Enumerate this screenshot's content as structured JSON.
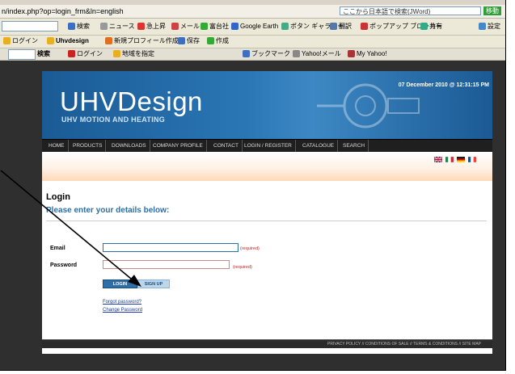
{
  "browser": {
    "url": "n/index.php?op=login_frm&ln=english",
    "search_placeholder": "ここから日本語で検索(JWord)",
    "go_label": "移動",
    "toolbar1": [
      "検索",
      "ニュース",
      "急上昇",
      "メール",
      "富台社",
      "Google Earth",
      "ポタン ギャラリー",
      "翻訳",
      "ポップアップ ブロッカー",
      "共有",
      "設定"
    ],
    "toolbar2": [
      "ログイン",
      "Uhvdesign",
      "新規プロフィール作成",
      "保存",
      "作成"
    ],
    "toolbar3": [
      "検索",
      "ログイン",
      "地域を指定",
      "ブックマーク",
      "Yahoo!メール",
      "My Yahoo!"
    ]
  },
  "site": {
    "logo": "UHVDesign",
    "tagline": "UHV MOTION AND HEATING",
    "datetime": "07 December 2010 @ 12:31:15 PM",
    "nav": [
      "HOME",
      "PRODUCTS",
      "DOWNLOADS",
      "COMPANY PROFILE",
      "CONTACT",
      "LOGIN / REGISTER",
      "CATALOGUE",
      "SEARCH"
    ],
    "flags": [
      {
        "name": "uk-flag",
        "colors": [
          "#c8102e",
          "#012169"
        ]
      },
      {
        "name": "italy-flag",
        "colors": [
          "#009246",
          "#ffffff",
          "#ce2b37"
        ]
      },
      {
        "name": "germany-flag",
        "colors": [
          "#000000",
          "#dd0000",
          "#ffce00"
        ]
      },
      {
        "name": "france-flag",
        "colors": [
          "#0055a4",
          "#ffffff",
          "#ef4135"
        ]
      }
    ]
  },
  "login": {
    "title": "Login",
    "subtitle": "Please enter your details below:",
    "email_label": "Email",
    "password_label": "Password",
    "required": "(required)",
    "login_button": "LOGIN",
    "signup_button": "SIGN UP",
    "forgot_link": "Forgot password?",
    "change_link": "Change Password"
  },
  "footer": {
    "links": "PRIVACY POLICY // CONDITIONS OF SALE // TERMS & CONDITIONS // SITE MAP"
  },
  "colors": {
    "banner_blue": "#2a76b5",
    "link_blue": "#2a6fa8",
    "nav_bg": "#1f1f1f"
  }
}
